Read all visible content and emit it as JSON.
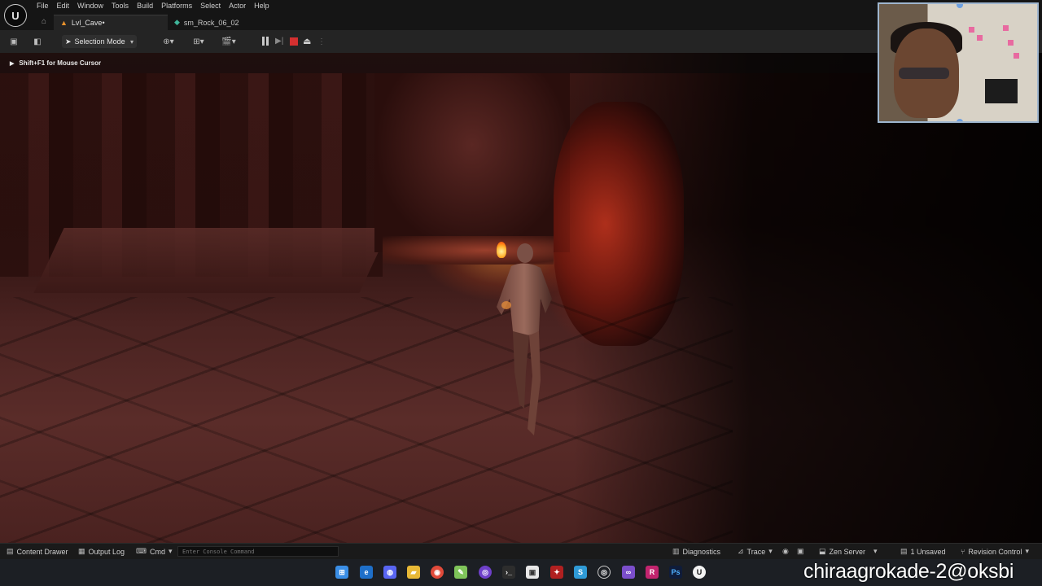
{
  "menu": {
    "items": [
      "File",
      "Edit",
      "Window",
      "Tools",
      "Build",
      "Platforms",
      "Select",
      "Actor",
      "Help"
    ]
  },
  "tabs": [
    {
      "label": "Lvl_Cave•",
      "icon": "level-icon"
    },
    {
      "label": "sm_Rock_06_02",
      "icon": "static-mesh-icon"
    }
  ],
  "toolbar": {
    "selection_mode": "Selection Mode"
  },
  "viewport": {
    "hint": "Shift+F1 for Mouse Cursor"
  },
  "statusbar": {
    "content_drawer": "Content Drawer",
    "output_log": "Output Log",
    "cmd": "Cmd",
    "console_placeholder": "Enter Console Command",
    "diagnostics": "Diagnostics",
    "trace": "Trace",
    "zen_server": "Zen Server",
    "unsaved": "1 Unsaved",
    "revision_control": "Revision Control"
  },
  "taskbar": {
    "apps": [
      "windows-start",
      "edge",
      "discord",
      "file-explorer",
      "chrome",
      "notepad-plus",
      "github",
      "terminal",
      "app-store",
      "red-app",
      "sourcetree",
      "obs",
      "visual-studio",
      "rider",
      "photoshop",
      "unreal-engine"
    ]
  },
  "overlay": {
    "watermark": "chiraagrokade-2@oksbi"
  },
  "colors": {
    "accent_level": "#e8922c",
    "accent_mesh": "#3fb69b",
    "stop": "#d43030"
  }
}
